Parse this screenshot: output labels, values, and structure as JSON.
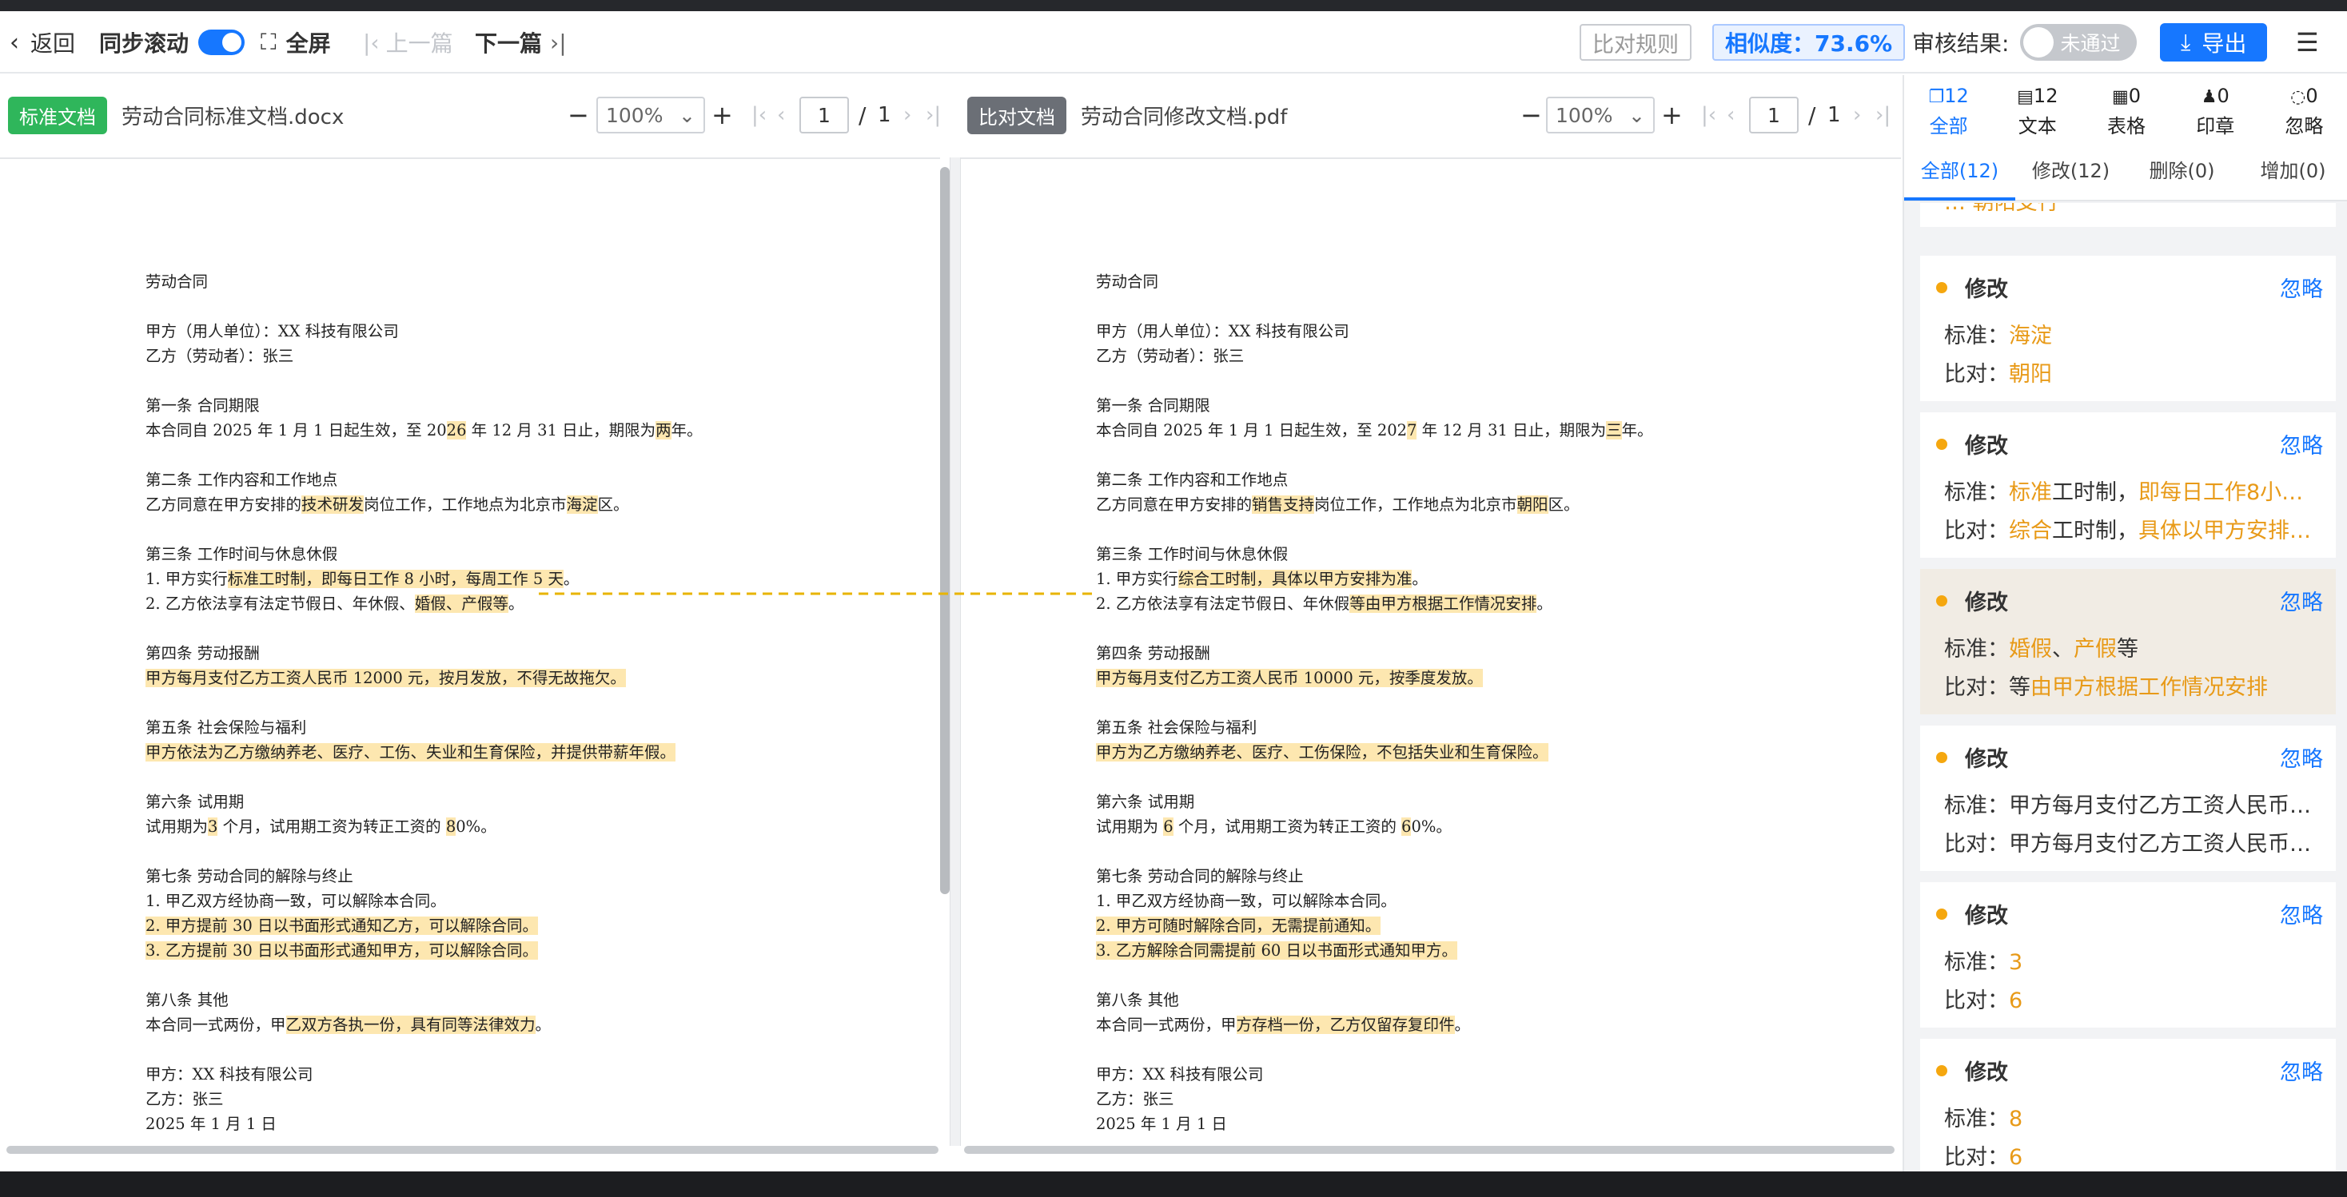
{
  "toolbar": {
    "back": "返回",
    "sync": "同步滚动",
    "fullscreen": "全屏",
    "prev": "上一篇",
    "next": "下一篇",
    "rules": "比对规则",
    "similarity": "相似度：73.6%",
    "review_label": "审核结果:",
    "review_status": "未通过",
    "export": "导出"
  },
  "left_doc": {
    "tag": "标准文档",
    "filename": "劳动合同标准文档.docx",
    "zoom": "100%",
    "page": "1",
    "total": "1"
  },
  "right_doc": {
    "tag": "比对文档",
    "filename": "劳动合同修改文档.pdf",
    "zoom": "100%",
    "page": "1",
    "total": "1"
  },
  "left_lines": [
    [
      {
        "t": "劳动合同"
      }
    ],
    [
      {
        "t": "甲方（用人单位）：XX 科技有限公司"
      }
    ],
    [
      {
        "t": "乙方（劳动者）：张三"
      }
    ],
    [
      {
        "t": "第一条  合同期限"
      }
    ],
    [
      {
        "t": "本合同自 2025 年 1 月 1 日起生效，至 20"
      },
      {
        "t": "26",
        "h": 1
      },
      {
        "t": " 年 12 月 31 日止，期限为"
      },
      {
        "t": "两",
        "h": 1
      },
      {
        "t": "年。"
      }
    ],
    [
      {
        "t": "第二条  工作内容和工作地点"
      }
    ],
    [
      {
        "t": "乙方同意在甲方安排的"
      },
      {
        "t": "技术研发",
        "h": 1
      },
      {
        "t": "岗位工作，工作地点为北京市"
      },
      {
        "t": "海淀",
        "h": 1
      },
      {
        "t": "区。"
      }
    ],
    [
      {
        "t": "第三条  工作时间与休息休假"
      }
    ],
    [
      {
        "t": "1.  甲方实行"
      },
      {
        "t": "标准工时制，即每日工作 8 小时，每周工作 5 天",
        "h": 1
      },
      {
        "t": "。"
      }
    ],
    [
      {
        "t": "2.  乙方依法享有法定节假日、年休假、"
      },
      {
        "t": "婚假、产假等",
        "h": 1
      },
      {
        "t": "。"
      }
    ],
    [
      {
        "t": "第四条  劳动报酬"
      }
    ],
    [
      {
        "t": "甲方每月支付乙方工资人民币 12000 元，按月发放，不得无故拖欠。",
        "h": 1
      }
    ],
    [
      {
        "t": "第五条  社会保险与福利"
      }
    ],
    [
      {
        "t": "甲方依法为乙方缴纳养老、医疗、工伤、失业和生育保险，并提供带薪年假。",
        "h": 1
      }
    ],
    [
      {
        "t": "第六条  试用期"
      }
    ],
    [
      {
        "t": "试用期为"
      },
      {
        "t": "3",
        "h": 1
      },
      {
        "t": " 个月，试用期工资为转正工资的 "
      },
      {
        "t": "8",
        "h": 1
      },
      {
        "t": "0%。"
      }
    ],
    [
      {
        "t": "第七条  劳动合同的解除与终止"
      }
    ],
    [
      {
        "t": "1.  甲乙双方经协商一致，可以解除本合同。"
      }
    ],
    [
      {
        "t": "2.  甲方提前 30 日以书面形式通知乙方，可以解除合同。",
        "h": 1
      }
    ],
    [
      {
        "t": "3.  乙方提前 30 日以书面形式通知甲方，可以解除合同。",
        "h": 1
      }
    ],
    [
      {
        "t": "第八条  其他"
      }
    ],
    [
      {
        "t": "本合同一式两份，甲"
      },
      {
        "t": "乙双方各执一份，具有同等法律效力",
        "h": 1
      },
      {
        "t": "。"
      }
    ],
    [
      {
        "t": "甲方：XX 科技有限公司"
      }
    ],
    [
      {
        "t": "乙方：张三"
      }
    ],
    [
      {
        "t": "2025 年 1 月 1 日"
      }
    ]
  ],
  "right_lines": [
    [
      {
        "t": "劳动合同"
      }
    ],
    [
      {
        "t": "甲方（用人单位）：XX 科技有限公司"
      }
    ],
    [
      {
        "t": "乙方（劳动者）：张三"
      }
    ],
    [
      {
        "t": "第一条  合同期限"
      }
    ],
    [
      {
        "t": "本合同自 2025 年 1 月 1 日起生效，至 202"
      },
      {
        "t": "7",
        "h": 1
      },
      {
        "t": " 年 12 月 31 日止，期限为"
      },
      {
        "t": "三",
        "h": 1
      },
      {
        "t": "年。"
      }
    ],
    [
      {
        "t": "第二条  工作内容和工作地点"
      }
    ],
    [
      {
        "t": "乙方同意在甲方安排的"
      },
      {
        "t": "销售支持",
        "h": 1
      },
      {
        "t": "岗位工作，工作地点为北京市"
      },
      {
        "t": "朝阳",
        "h": 1
      },
      {
        "t": "区。"
      }
    ],
    [
      {
        "t": "第三条  工作时间与休息休假"
      }
    ],
    [
      {
        "t": "1.  甲方实行"
      },
      {
        "t": "综合工时制，具体以甲方安排为准",
        "h": 1
      },
      {
        "t": "。"
      }
    ],
    [
      {
        "t": "2.  乙方依法享有法定节假日、年休假"
      },
      {
        "t": "等由甲方根据工作情况安排",
        "h": 1
      },
      {
        "t": "。"
      }
    ],
    [
      {
        "t": "第四条  劳动报酬"
      }
    ],
    [
      {
        "t": "甲方每月支付乙方工资人民币 10000 元，按季度发放。",
        "h": 1
      }
    ],
    [
      {
        "t": "第五条  社会保险与福利"
      }
    ],
    [
      {
        "t": "甲方为乙方缴纳养老、医疗、工伤保险，不包括失业和生育保险。",
        "h": 1
      }
    ],
    [
      {
        "t": "第六条  试用期"
      }
    ],
    [
      {
        "t": "试用期为 "
      },
      {
        "t": "6",
        "h": 1
      },
      {
        "t": " 个月，试用期工资为转正工资的 "
      },
      {
        "t": "6",
        "h": 1
      },
      {
        "t": "0%。"
      }
    ],
    [
      {
        "t": "第七条  劳动合同的解除与终止"
      }
    ],
    [
      {
        "t": "1.  甲乙双方经协商一致，可以解除本合同。"
      }
    ],
    [
      {
        "t": "2.  甲方可随时解除合同，无需提前通知。",
        "h": 1
      }
    ],
    [
      {
        "t": "3.  乙方解除合同需提前 60 日以书面形式通知甲方。",
        "h": 1
      }
    ],
    [
      {
        "t": "第八条  其他"
      }
    ],
    [
      {
        "t": "本合同一式两份，甲"
      },
      {
        "t": "方存档一份，乙方仅留存复印件",
        "h": 1
      },
      {
        "t": "。"
      }
    ],
    [
      {
        "t": "甲方：XX 科技有限公司"
      }
    ],
    [
      {
        "t": "乙方：张三"
      }
    ],
    [
      {
        "t": "2025 年 1 月 1 日"
      }
    ]
  ],
  "sidebar": {
    "categories": [
      {
        "icon": "copy-icon",
        "count": "12",
        "label": "全部"
      },
      {
        "icon": "file-icon",
        "count": "12",
        "label": "文本"
      },
      {
        "icon": "table-icon",
        "count": "0",
        "label": "表格"
      },
      {
        "icon": "stamp-icon",
        "count": "0",
        "label": "印章"
      },
      {
        "icon": "eye-off-icon",
        "count": "0",
        "label": "忽略"
      }
    ],
    "subtabs": [
      "全部(12)",
      "修改(12)",
      "删除(0)",
      "增加(0)"
    ],
    "partial_top": "…  朝阳支行",
    "std_label": "标准：",
    "cmp_label": "比对：",
    "cards": [
      {
        "type": "修改",
        "ignore": "忽略",
        "std": [
          {
            "t": "海淀",
            "h": 1
          }
        ],
        "cmp": [
          {
            "t": "朝阳",
            "h": 1
          }
        ]
      },
      {
        "type": "修改",
        "ignore": "忽略",
        "std": [
          {
            "t": "标准",
            "h": 1
          },
          {
            "t": "工时制，"
          },
          {
            "t": "即每日工作8小…",
            "h": 1
          }
        ],
        "cmp": [
          {
            "t": "综合",
            "h": 1
          },
          {
            "t": "工时制，"
          },
          {
            "t": "具体以甲方安排…",
            "h": 1
          }
        ]
      },
      {
        "type": "修改",
        "ignore": "忽略",
        "std": [
          {
            "t": "婚假",
            "h": 1
          },
          {
            "t": "、"
          },
          {
            "t": "产假",
            "h": 1
          },
          {
            "t": "等"
          }
        ],
        "cmp": [
          {
            "t": "等"
          },
          {
            "t": "由甲方根据工作情况安排",
            "h": 1
          }
        ]
      },
      {
        "type": "修改",
        "ignore": "忽略",
        "std": [
          {
            "t": "甲方每月支付乙方工资人民币1…"
          }
        ],
        "cmp": [
          {
            "t": "甲方每月支付乙方工资人民币1…"
          }
        ]
      },
      {
        "type": "修改",
        "ignore": "忽略",
        "std": [
          {
            "t": "3",
            "h": 1
          }
        ],
        "cmp": [
          {
            "t": "6",
            "h": 1
          }
        ]
      },
      {
        "type": "修改",
        "ignore": "忽略",
        "std": [
          {
            "t": "8",
            "h": 1
          }
        ],
        "cmp": [
          {
            "t": "6",
            "h": 1
          }
        ]
      }
    ]
  },
  "colors": {
    "accent": "#1677ff",
    "diff_highlight": "#fde7b0",
    "change_text": "#e89a18",
    "dot": "#f5a70f",
    "std_tag": "#2fb65b",
    "cmp_tag": "#6b6f76"
  }
}
